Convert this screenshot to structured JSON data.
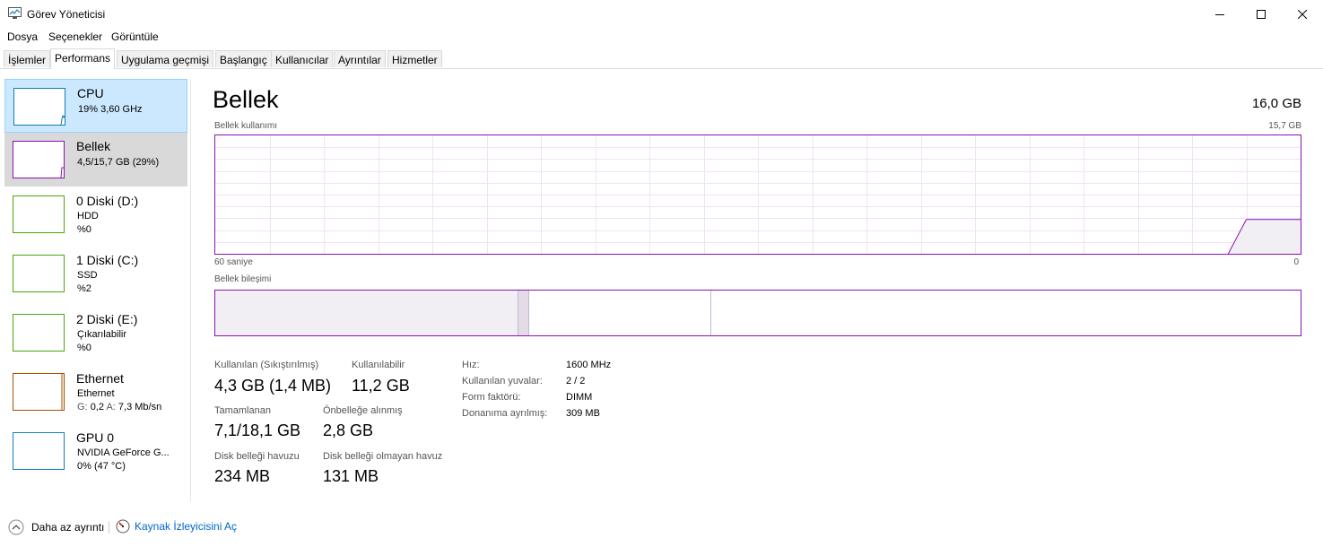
{
  "window": {
    "title": "Görev Yöneticisi",
    "icon": "task-manager-icon"
  },
  "menu": [
    "Dosya",
    "Seçenekler",
    "Görüntüle"
  ],
  "tabs": [
    "İşlemler",
    "Performans",
    "Uygulama geçmişi",
    "Başlangıç",
    "Kullanıcılar",
    "Ayrıntılar",
    "Hizmetler"
  ],
  "active_tab": "Performans",
  "sidebar": {
    "items": [
      {
        "title": "CPU",
        "line1": "19%  3,60 GHz",
        "line2": "",
        "color": "#117dbb",
        "state": "selected"
      },
      {
        "title": "Bellek",
        "line1": "4,5/15,7 GB (29%)",
        "line2": "",
        "color": "#8b12ae",
        "state": "hover"
      },
      {
        "title": "0 Diski (D:)",
        "line1": "HDD",
        "line2": "%0",
        "color": "#4da60c",
        "state": ""
      },
      {
        "title": "1 Diski (C:)",
        "line1": "SSD",
        "line2": "%2",
        "color": "#4da60c",
        "state": ""
      },
      {
        "title": "2 Diski (E:)",
        "line1": "Çıkarılabilir",
        "line2": "%0",
        "color": "#4da60c",
        "state": ""
      },
      {
        "title": "Ethernet",
        "line1": "Ethernet",
        "line2_g_label": "G:",
        "line2_g_value": "0,2",
        "line2_a_label": "A:",
        "line2_a_value": "7,3 Mb/sn",
        "color": "#a74f01",
        "state": ""
      },
      {
        "title": "GPU 0",
        "line1": "NVIDIA GeForce G...",
        "line2": "0% (47 °C)",
        "color": "#117dbb",
        "state": ""
      }
    ]
  },
  "main": {
    "title": "Bellek",
    "total": "16,0 GB",
    "usage_label": "Bellek kullanımı",
    "usage_max": "15,7 GB",
    "axis_left": "60 saniye",
    "axis_right": "0",
    "usage_history_fraction": [
      0,
      0,
      0,
      0,
      0,
      0,
      0,
      0,
      0,
      0,
      0,
      0,
      0,
      0,
      0,
      0,
      0,
      0,
      0,
      0,
      0,
      0,
      0,
      0,
      0,
      0,
      0,
      0,
      0,
      0,
      0,
      0,
      0,
      0,
      0,
      0,
      0,
      0,
      0,
      0,
      0,
      0,
      0,
      0,
      0,
      0,
      0,
      0,
      0,
      0,
      0,
      0,
      0,
      0,
      0,
      0,
      0,
      0.29,
      0.29,
      0.29,
      0.29
    ],
    "composition_label": "Bellek bileşimi",
    "composition": {
      "in_use_fraction": 0.279,
      "modified_fraction": 0.01,
      "standby_fraction": 0.168,
      "free_fraction": 0.543
    },
    "stats": {
      "in_use_label": "Kullanılan (Sıkıştırılmış)",
      "in_use_value": "4,3 GB (1,4 MB)",
      "available_label": "Kullanılabilir",
      "available_value": "11,2 GB",
      "committed_label": "Tamamlanan",
      "committed_value": "7,1/18,1 GB",
      "cached_label": "Önbelleğe alınmış",
      "cached_value": "2,8 GB",
      "paged_label": "Disk belleği havuzu",
      "paged_value": "234 MB",
      "nonpaged_label": "Disk belleği olmayan havuz",
      "nonpaged_value": "131 MB"
    },
    "specs": {
      "speed_label": "Hız:",
      "speed_value": "1600 MHz",
      "slots_label": "Kullanılan yuvalar:",
      "slots_value": "2 / 2",
      "form_label": "Form faktörü:",
      "form_value": "DIMM",
      "reserved_label": "Donanıma ayrılmış:",
      "reserved_value": "309 MB"
    },
    "accent_color": "#8b12ae"
  },
  "footer": {
    "fewer_details": "Daha az ayrıntı",
    "resource_monitor": "Kaynak İzleyicisini Aç"
  }
}
